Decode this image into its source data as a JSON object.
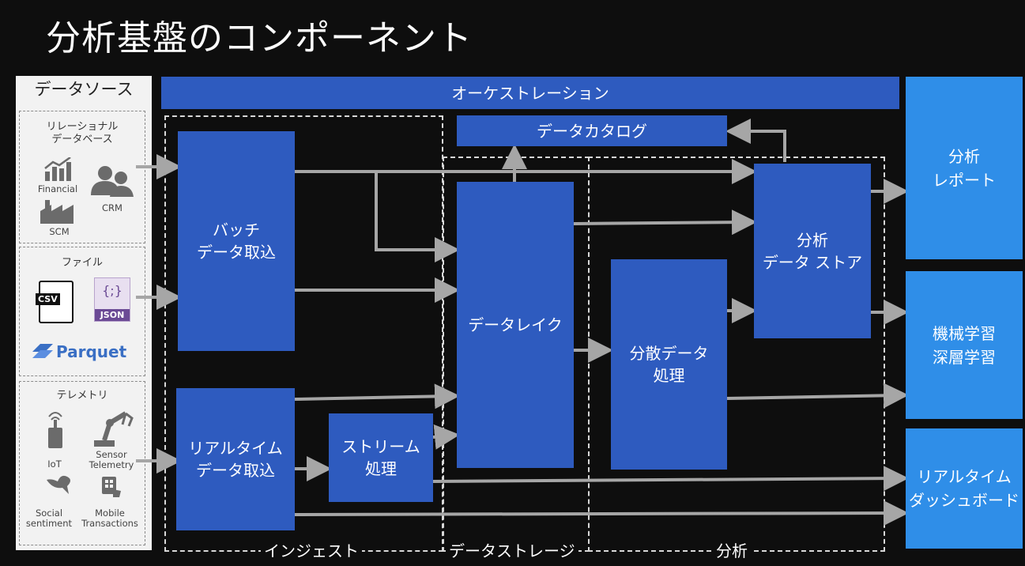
{
  "title": "分析基盤のコンポーネント",
  "sources": {
    "header": "データソース",
    "rdb": {
      "title": "リレーショナル\nデータベース",
      "financial": "Financial",
      "crm": "CRM",
      "scm": "SCM"
    },
    "file": {
      "title": "ファイル",
      "csv": "CSV",
      "json_braces": "{;}",
      "json": "JSON",
      "parquet": "Parquet"
    },
    "telemetry": {
      "title": "テレメトリ",
      "iot": "IoT",
      "sensor": "Sensor\nTelemetry",
      "social": "Social\nsentiment",
      "mobile": "Mobile\nTransactions"
    }
  },
  "blocks": {
    "orchestration": "オーケストレーション",
    "catalog": "データカタログ",
    "batch": "バッチ\nデータ取込",
    "realtime_ingest": "リアルタイム\nデータ取込",
    "stream": "ストリーム\n処理",
    "datalake": "データレイク",
    "distributed": "分散データ\n処理",
    "analytics_store": "分析\nデータ ストア"
  },
  "outputs": {
    "report": "分析\nレポート",
    "ml": "機械学習\n深層学習",
    "dashboard": "リアルタイム\nダッシュボード"
  },
  "zones": {
    "ingest": "インジェスト",
    "storage": "データストレージ",
    "analysis": "分析"
  },
  "colors": {
    "block": "#2e5bbf",
    "output": "#2f8ee8",
    "arrow": "#a6a6a6",
    "background": "#0e0e0e"
  }
}
